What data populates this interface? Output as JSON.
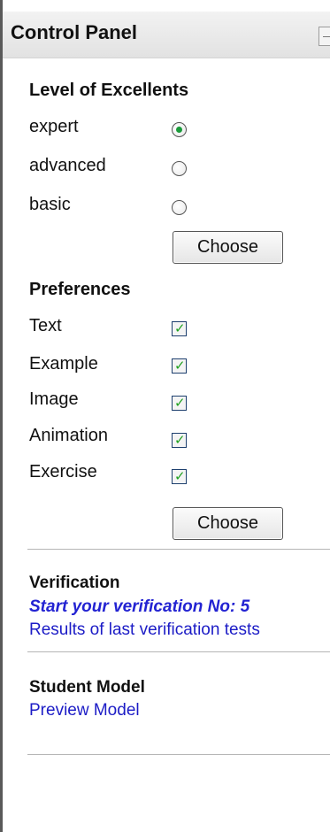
{
  "panel": {
    "title": "Control Panel",
    "collapse_glyph": "−"
  },
  "level": {
    "heading": "Level of Excellents",
    "options": [
      {
        "label": "expert",
        "selected": true
      },
      {
        "label": "advanced",
        "selected": false
      },
      {
        "label": "basic",
        "selected": false
      }
    ],
    "button_label": "Choose"
  },
  "preferences": {
    "heading": "Preferences",
    "items": [
      {
        "label": "Text",
        "checked": true
      },
      {
        "label": "Example",
        "checked": true
      },
      {
        "label": "Image",
        "checked": true
      },
      {
        "label": "Animation",
        "checked": true
      },
      {
        "label": "Exercise",
        "checked": true
      }
    ],
    "button_label": "Choose"
  },
  "verification": {
    "heading": "Verification",
    "start_link": "Start your verification No: 5",
    "results_link": "Results of last verification tests"
  },
  "student_model": {
    "heading": "Student Model",
    "preview_link": "Preview Model"
  },
  "icons": {
    "check": "check-icon",
    "collapse": "minus-icon"
  },
  "colors": {
    "link": "#1c1cc6",
    "check": "#21a121",
    "radio_selected": "#1a9a3a"
  }
}
